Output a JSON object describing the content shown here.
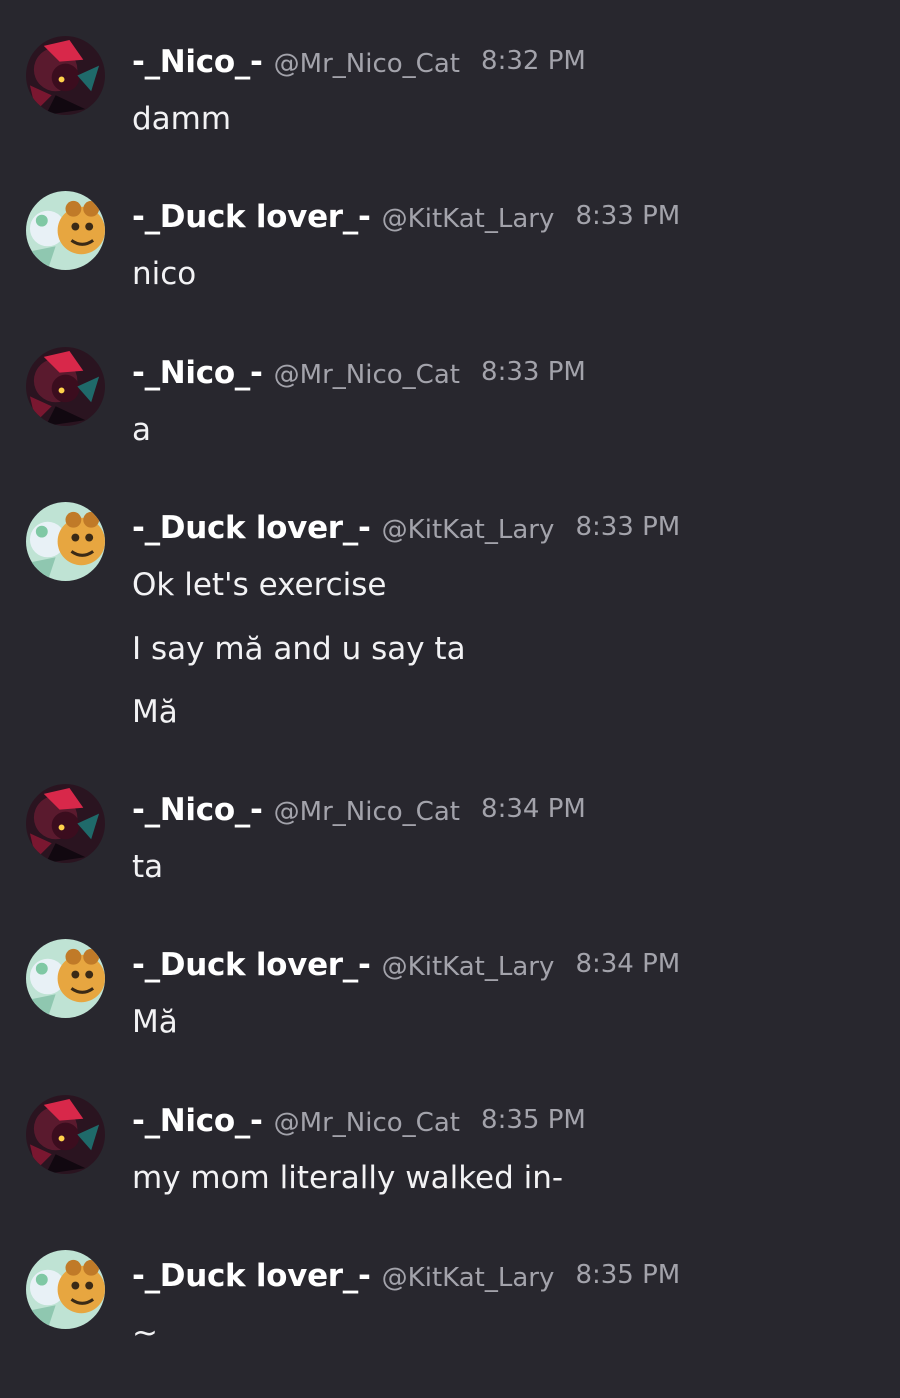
{
  "messages": [
    {
      "author": "-_Nico_-",
      "handle": "@Mr_Nico_Cat",
      "time": "8:32 PM",
      "avatar_icon": "nico-avatar",
      "lines": [
        "damm"
      ]
    },
    {
      "author": "-_Duck lover_-",
      "handle": "@KitKat_Lary",
      "time": "8:33 PM",
      "avatar_icon": "duck-lover-avatar",
      "lines": [
        "nico"
      ]
    },
    {
      "author": "-_Nico_-",
      "handle": "@Mr_Nico_Cat",
      "time": "8:33 PM",
      "avatar_icon": "nico-avatar",
      "lines": [
        "a"
      ]
    },
    {
      "author": "-_Duck lover_-",
      "handle": "@KitKat_Lary",
      "time": "8:33 PM",
      "avatar_icon": "duck-lover-avatar",
      "lines": [
        "Ok let's exercise",
        "I say mă and u say ta",
        "Mă"
      ]
    },
    {
      "author": "-_Nico_-",
      "handle": "@Mr_Nico_Cat",
      "time": "8:34 PM",
      "avatar_icon": "nico-avatar",
      "lines": [
        "ta"
      ]
    },
    {
      "author": "-_Duck lover_-",
      "handle": "@KitKat_Lary",
      "time": "8:34 PM",
      "avatar_icon": "duck-lover-avatar",
      "lines": [
        "Mă"
      ]
    },
    {
      "author": "-_Nico_-",
      "handle": "@Mr_Nico_Cat",
      "time": "8:35 PM",
      "avatar_icon": "nico-avatar",
      "lines": [
        "my mom literally walked in-"
      ]
    },
    {
      "author": "-_Duck lover_-",
      "handle": "@KitKat_Lary",
      "time": "8:35 PM",
      "avatar_icon": "duck-lover-avatar",
      "lines": [
        "~"
      ]
    }
  ],
  "colors": {
    "background": "#28272e",
    "text": "#f2f2f4",
    "muted": "#a3a3ab"
  }
}
